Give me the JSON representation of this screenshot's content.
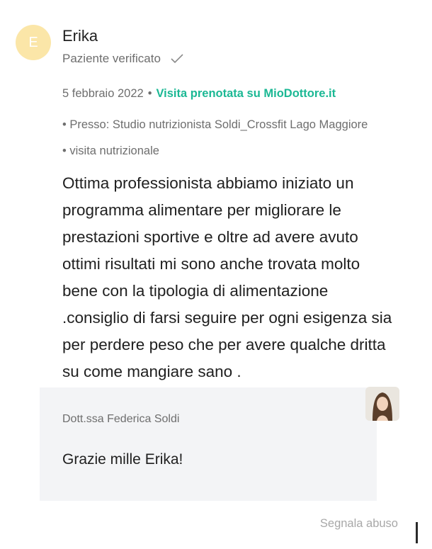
{
  "review": {
    "avatar_initial": "E",
    "author": "Erika",
    "verified_label": "Paziente verificato",
    "date": "5 febbraio 2022",
    "separator": "•",
    "booking_link": "Visita prenotata su MioDottore.it",
    "location_line": "• Presso: Studio nutrizionista Soldi_Crossfit Lago Maggiore • visita nutrizionale",
    "text": "Ottima professionista abbiamo iniziato un programma alimentare per migliorare le prestazioni sportive e oltre ad avere avuto ottimi risultati mi sono anche trovata molto bene con la tipologia di alimentazione .consiglio di farsi seguire per ogni esigenza sia per perdere peso che per avere qualche dritta su come mangiare sano ."
  },
  "reply": {
    "author": "Dott.ssa Federica Soldi",
    "text": "Grazie mille Erika!"
  },
  "actions": {
    "report_abuse": "Segnala abuso"
  },
  "colors": {
    "accent": "#1bb894",
    "avatar_bg": "#fbe6a8",
    "reply_bg": "#f3f4f6"
  }
}
